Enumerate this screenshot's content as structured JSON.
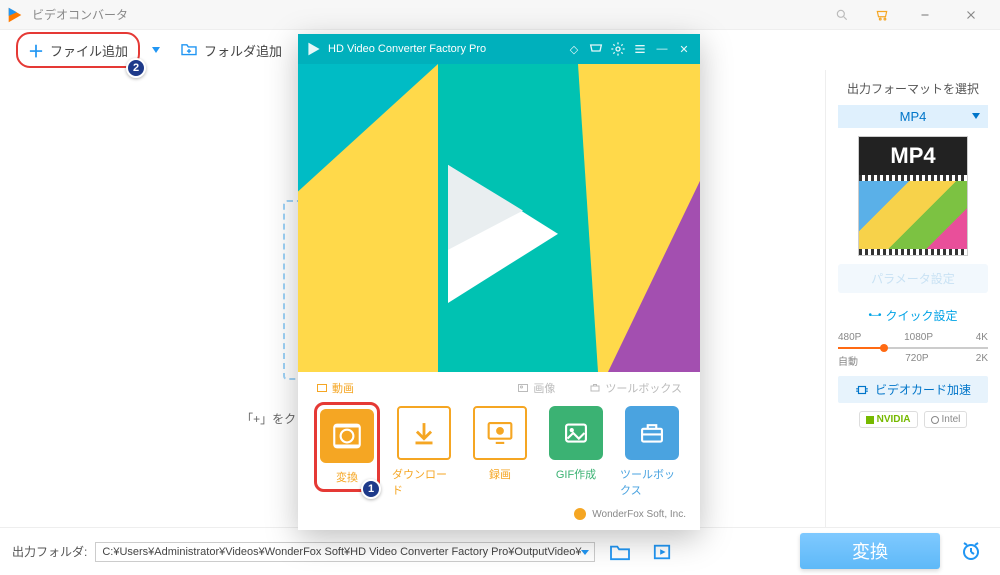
{
  "titlebar": {
    "title": "ビデオコンバータ"
  },
  "toolbar": {
    "add_file": "ファイル追加",
    "add_folder": "フォルダ追加"
  },
  "workspace": {
    "hint": "「+」をクリックしてファイルを追加、または直接ドラッグする"
  },
  "right": {
    "title": "出力フォーマットを選択",
    "format": "MP4",
    "format_big": "MP4",
    "param_btn": "パラメータ設定",
    "quick_title": "クイック設定",
    "res": [
      "480P",
      "1080P",
      "4K"
    ],
    "res2": [
      "自動",
      "720P",
      "2K"
    ],
    "gpu_btn": "ビデオカード加速",
    "nvidia": "NVIDIA",
    "intel": "Intel"
  },
  "bottom": {
    "label": "出力フォルダ:",
    "path": "C:¥Users¥Administrator¥Videos¥WonderFox Soft¥HD Video Converter Factory Pro¥OutputVideo¥",
    "convert": "変換"
  },
  "launcher": {
    "title": "HD Video Converter Factory Pro",
    "cat_video": "動画",
    "cat_image": "画像",
    "cat_tool": "ツールボックス",
    "tiles": {
      "convert": "変換",
      "download": "ダウンロード",
      "record": "録画",
      "gif": "GIF作成",
      "toolbox": "ツールボックス"
    },
    "footer": "WonderFox Soft, Inc."
  },
  "badges": {
    "one": "1",
    "two": "2"
  }
}
